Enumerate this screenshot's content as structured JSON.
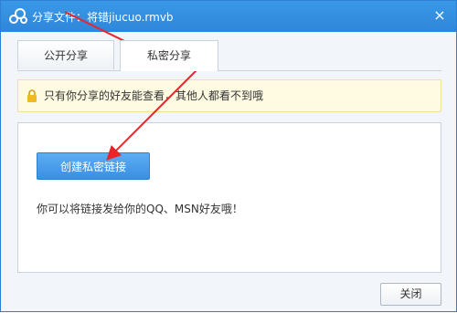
{
  "window": {
    "title": "分享文件：将错jiucuo.rmvb",
    "close_glyph": "×"
  },
  "tabs": [
    {
      "label": "公开分享",
      "active": false
    },
    {
      "label": "私密分享",
      "active": true
    }
  ],
  "notice": {
    "icon": "lock-icon",
    "text": "只有你分享的好友能查看，其他人都看不到哦"
  },
  "content": {
    "create_button": "创建私密链接",
    "tip": "你可以将链接发给你的QQ、MSN好友哦！"
  },
  "footer": {
    "close_button": "关闭"
  },
  "colors": {
    "title_bar": "#2f86da",
    "annotation_arrow": "#e8262a",
    "primary_button": "#3c8ee1"
  }
}
